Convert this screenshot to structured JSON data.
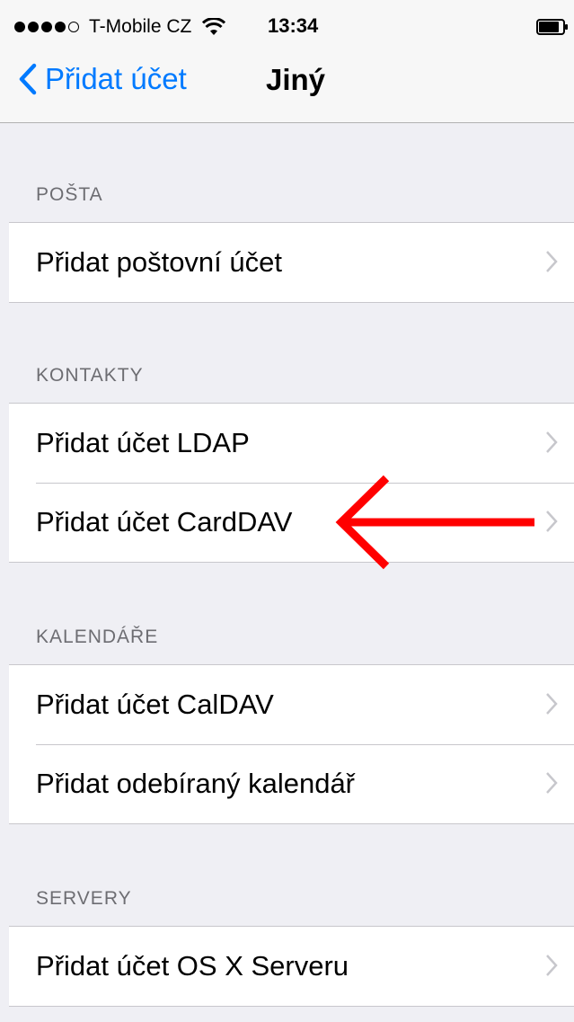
{
  "status_bar": {
    "carrier": "T-Mobile CZ",
    "time": "13:34",
    "signal_icon": "signal-dots-icon",
    "wifi_icon": "wifi-icon",
    "battery_icon": "battery-icon"
  },
  "nav": {
    "back_label": "Přidat účet",
    "title": "Jiný",
    "back_icon": "chevron-left-icon"
  },
  "sections": [
    {
      "header": "POŠTA",
      "items": [
        "Přidat poštovní účet"
      ]
    },
    {
      "header": "KONTAKTY",
      "items": [
        "Přidat účet LDAP",
        "Přidat účet CardDAV"
      ]
    },
    {
      "header": "KALENDÁŘE",
      "items": [
        "Přidat účet CalDAV",
        "Přidat odebíraný kalendář"
      ]
    },
    {
      "header": "SERVERY",
      "items": [
        "Přidat účet OS X Serveru"
      ]
    }
  ],
  "colors": {
    "accent": "#007aff",
    "background": "#efeff4",
    "annotation_arrow": "#ff0000"
  }
}
